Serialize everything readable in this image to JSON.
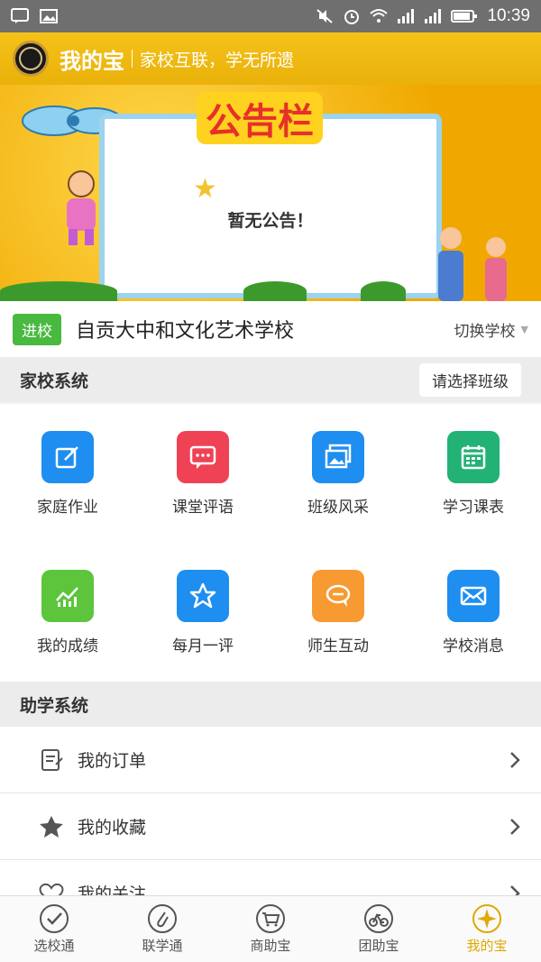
{
  "status_bar": {
    "time": "10:39"
  },
  "app": {
    "title": "我的宝",
    "slogan": "家校互联，学无所遗"
  },
  "banner": {
    "title": "公告栏",
    "notice": "暂无公告！"
  },
  "school": {
    "tag": "进校",
    "name": "自贡大中和文化艺术学校",
    "switch_label": "切换学校"
  },
  "home_school": {
    "heading": "家校系统",
    "class_select": "请选择班级",
    "items": [
      {
        "label": "家庭作业",
        "icon": "homework-icon",
        "color": "#1e8ef0"
      },
      {
        "label": "课堂评语",
        "icon": "comment-icon",
        "color": "#ef4255"
      },
      {
        "label": "班级风采",
        "icon": "gallery-icon",
        "color": "#1e8ef0"
      },
      {
        "label": "学习课表",
        "icon": "calendar-icon",
        "color": "#22b276"
      },
      {
        "label": "我的成绩",
        "icon": "chart-icon",
        "color": "#5cc53c"
      },
      {
        "label": "每月一评",
        "icon": "star-icon",
        "color": "#1e8ef0"
      },
      {
        "label": "师生互动",
        "icon": "chat-icon",
        "color": "#f89a32"
      },
      {
        "label": "学校消息",
        "icon": "mail-icon",
        "color": "#1e8ef0"
      }
    ]
  },
  "study": {
    "heading": "助学系统",
    "items": [
      {
        "label": "我的订单",
        "icon": "order-icon"
      },
      {
        "label": "我的收藏",
        "icon": "favorite-star-icon"
      },
      {
        "label": "我的关注",
        "icon": "heart-icon"
      }
    ]
  },
  "bottom_nav": {
    "items": [
      {
        "label": "选校通",
        "icon": "check-circle-icon"
      },
      {
        "label": "联学通",
        "icon": "paperclip-icon"
      },
      {
        "label": "商助宝",
        "icon": "cart-icon"
      },
      {
        "label": "团助宝",
        "icon": "bicycle-icon"
      },
      {
        "label": "我的宝",
        "icon": "sparkle-icon",
        "active": true
      }
    ]
  },
  "colors": {
    "accent": "#f5c21a",
    "active_nav": "#e0a800"
  }
}
